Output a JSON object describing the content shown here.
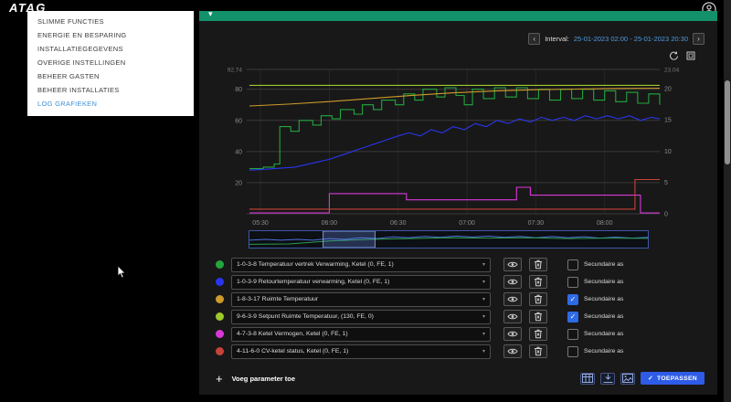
{
  "colors": {
    "accent_blue": "#4e9ae0",
    "apply_blue": "#2e5ce6",
    "active_menu": "#3f8fd6",
    "checkbox_checked": "#2e6be6",
    "header_green": "#12916a"
  },
  "brand": {
    "logo_text": "ATAG"
  },
  "sidebar": {
    "items": [
      {
        "label": "SLIMME FUNCTIES",
        "active": false
      },
      {
        "label": "ENERGIE EN BESPARING",
        "active": false
      },
      {
        "label": "INSTALLATIEGEGEVENS",
        "active": false
      },
      {
        "label": "OVERIGE INSTELLINGEN",
        "active": false
      },
      {
        "label": "BEHEER GASTEN",
        "active": false
      },
      {
        "label": "BEHEER INSTALLATIES",
        "active": false
      },
      {
        "label": "LOG GRAFIEKEN",
        "active": true
      }
    ]
  },
  "panel": {
    "header": {
      "collapse_glyph": "▾"
    },
    "interval": {
      "label": "Interval:",
      "value": "25-01-2023 02:00 - 25-01-2023 20:30",
      "prev_icon": "‹",
      "next_icon": "›"
    }
  },
  "legend": {
    "secondary_axis_label": "Secundaire as",
    "rows": [
      {
        "color": "#23a63e",
        "label": "1-0-3-8 Temperatuur vertrek Verwarming, Ketel (0, FE, 1)",
        "secondary": false
      },
      {
        "color": "#2a35f0",
        "label": "1-0-3-9 Retourtemperatuur verwarming, Ketel (0, FE, 1)",
        "secondary": false
      },
      {
        "color": "#cf9b2a",
        "label": "1-8-3-17 Ruimte Temperatuur",
        "secondary": true
      },
      {
        "color": "#9dc92c",
        "label": "9-6-3-9 Setpunt Ruimte Temperatuur, (130, FE, 0)",
        "secondary": true
      },
      {
        "color": "#d938d9",
        "label": "4-7-3-8 Ketel Vermogen, Ketel (0, FE, 1)",
        "secondary": false
      },
      {
        "color": "#c8423a",
        "label": "4-11-6-0 CV-ketel status, Ketel (0, FE, 1)",
        "secondary": false
      }
    ]
  },
  "footer": {
    "add_icon": "+",
    "add_label": "Voeg parameter toe",
    "apply_icon": "✓",
    "apply_label": "TOEPASSEN",
    "toolbar_icons": [
      "table",
      "download",
      "image"
    ]
  },
  "chart_data": {
    "type": "line",
    "title": "",
    "x_domain": [
      5.4,
      8.4
    ],
    "x_ticks": [
      {
        "v": 5.5,
        "label": "05:30"
      },
      {
        "v": 6.0,
        "label": "06:00"
      },
      {
        "v": 6.5,
        "label": "06:30"
      },
      {
        "v": 7.0,
        "label": "07:00"
      },
      {
        "v": 7.5,
        "label": "07:30"
      },
      {
        "v": 8.0,
        "label": "08:00"
      }
    ],
    "left_axis": {
      "max": 92.74,
      "top_label": "92.74",
      "ticks": [
        20,
        40,
        60,
        80
      ]
    },
    "right_axis": {
      "max": 23.04,
      "top_label": "23.04",
      "ticks": [
        5,
        10,
        15,
        20
      ],
      "bottom_label": "0"
    },
    "series": [
      {
        "name": "Temperatuur vertrek Verwarming",
        "color": "#23a63e",
        "axis": "left",
        "step": true,
        "points": [
          [
            5.42,
            29
          ],
          [
            5.52,
            30
          ],
          [
            5.6,
            32
          ],
          [
            5.64,
            56
          ],
          [
            5.72,
            53
          ],
          [
            5.78,
            60
          ],
          [
            5.88,
            57
          ],
          [
            5.94,
            63
          ],
          [
            6.02,
            61
          ],
          [
            6.08,
            67
          ],
          [
            6.18,
            64
          ],
          [
            6.24,
            70
          ],
          [
            6.32,
            67
          ],
          [
            6.38,
            73
          ],
          [
            6.48,
            70
          ],
          [
            6.54,
            77
          ],
          [
            6.62,
            73
          ],
          [
            6.68,
            80
          ],
          [
            6.78,
            75
          ],
          [
            6.84,
            81
          ],
          [
            6.92,
            76
          ],
          [
            6.98,
            70
          ],
          [
            7.04,
            80
          ],
          [
            7.12,
            74
          ],
          [
            7.2,
            81
          ],
          [
            7.28,
            75
          ],
          [
            7.36,
            81
          ],
          [
            7.44,
            74
          ],
          [
            7.52,
            80
          ],
          [
            7.6,
            73
          ],
          [
            7.68,
            80
          ],
          [
            7.76,
            74
          ],
          [
            7.84,
            80
          ],
          [
            7.92,
            73
          ],
          [
            8.0,
            79
          ],
          [
            8.08,
            72
          ],
          [
            8.16,
            78
          ],
          [
            8.24,
            71
          ],
          [
            8.32,
            77
          ],
          [
            8.4,
            70
          ]
        ]
      },
      {
        "name": "Retourtemperatuur verwarming",
        "color": "#2a35f0",
        "axis": "left",
        "step": false,
        "points": [
          [
            5.42,
            28
          ],
          [
            5.6,
            29
          ],
          [
            5.75,
            30
          ],
          [
            5.9,
            33
          ],
          [
            6.0,
            35
          ],
          [
            6.1,
            38
          ],
          [
            6.2,
            41
          ],
          [
            6.3,
            44
          ],
          [
            6.4,
            47
          ],
          [
            6.5,
            50
          ],
          [
            6.58,
            52
          ],
          [
            6.66,
            50
          ],
          [
            6.74,
            54
          ],
          [
            6.82,
            52
          ],
          [
            6.9,
            56
          ],
          [
            6.98,
            54
          ],
          [
            7.06,
            58
          ],
          [
            7.14,
            56
          ],
          [
            7.22,
            60
          ],
          [
            7.3,
            58
          ],
          [
            7.38,
            61
          ],
          [
            7.46,
            59
          ],
          [
            7.54,
            62
          ],
          [
            7.62,
            60
          ],
          [
            7.7,
            62
          ],
          [
            7.78,
            60
          ],
          [
            7.86,
            63
          ],
          [
            7.94,
            61
          ],
          [
            8.02,
            63
          ],
          [
            8.1,
            61
          ],
          [
            8.18,
            63
          ],
          [
            8.26,
            60
          ],
          [
            8.34,
            62
          ],
          [
            8.4,
            61
          ]
        ]
      },
      {
        "name": "Ruimte Temperatuur",
        "color": "#cf9b2a",
        "axis": "right",
        "step": false,
        "points": [
          [
            5.42,
            17.2
          ],
          [
            5.7,
            17.5
          ],
          [
            6.0,
            17.9
          ],
          [
            6.3,
            18.4
          ],
          [
            6.6,
            18.9
          ],
          [
            6.9,
            19.3
          ],
          [
            7.2,
            19.6
          ],
          [
            7.5,
            19.8
          ],
          [
            7.8,
            19.9
          ],
          [
            8.1,
            20.0
          ],
          [
            8.4,
            20.05
          ]
        ]
      },
      {
        "name": "Setpunt Ruimte Temperatuur",
        "color": "#9dc92c",
        "axis": "right",
        "step": true,
        "points": [
          [
            5.42,
            20.5
          ],
          [
            8.4,
            20.5
          ]
        ]
      },
      {
        "name": "Ketel Vermogen",
        "color": "#d938d9",
        "axis": "left",
        "step": true,
        "points": [
          [
            5.42,
            0.5
          ],
          [
            5.98,
            0.5
          ],
          [
            6.0,
            13
          ],
          [
            6.54,
            13
          ],
          [
            6.56,
            9
          ],
          [
            7.34,
            9
          ],
          [
            7.36,
            17
          ],
          [
            7.44,
            17
          ],
          [
            7.46,
            12
          ],
          [
            8.24,
            12
          ],
          [
            8.26,
            0.5
          ],
          [
            8.4,
            0.5
          ]
        ]
      },
      {
        "name": "CV-ketel status",
        "color": "#c8423a",
        "axis": "left",
        "step": true,
        "points": [
          [
            5.42,
            3
          ],
          [
            8.2,
            3
          ],
          [
            8.22,
            22
          ],
          [
            8.4,
            22
          ]
        ]
      }
    ],
    "navigator": {
      "selection": [
        0.185,
        0.315
      ],
      "series": [
        {
          "color": "#4a6fd8",
          "points": [
            [
              0,
              0.55
            ],
            [
              0.04,
              0.5
            ],
            [
              0.08,
              0.55
            ],
            [
              0.12,
              0.5
            ],
            [
              0.16,
              0.55
            ],
            [
              0.2,
              0.45
            ],
            [
              0.24,
              0.5
            ],
            [
              0.28,
              0.4
            ],
            [
              0.32,
              0.45
            ],
            [
              0.36,
              0.35
            ],
            [
              0.4,
              0.4
            ],
            [
              0.44,
              0.32
            ],
            [
              0.48,
              0.38
            ],
            [
              0.52,
              0.3
            ],
            [
              0.56,
              0.36
            ],
            [
              0.6,
              0.3
            ],
            [
              0.64,
              0.38
            ],
            [
              0.68,
              0.32
            ],
            [
              0.72,
              0.4
            ],
            [
              0.76,
              0.33
            ],
            [
              0.8,
              0.4
            ],
            [
              0.84,
              0.34
            ],
            [
              0.88,
              0.42
            ],
            [
              0.92,
              0.36
            ],
            [
              0.96,
              0.42
            ],
            [
              1,
              0.38
            ]
          ]
        },
        {
          "color": "#2c9c4a",
          "points": [
            [
              0,
              0.8
            ],
            [
              0.1,
              0.78
            ],
            [
              0.2,
              0.6
            ],
            [
              0.3,
              0.5
            ],
            [
              0.4,
              0.45
            ],
            [
              0.5,
              0.4
            ],
            [
              0.6,
              0.42
            ],
            [
              0.7,
              0.4
            ],
            [
              0.8,
              0.45
            ],
            [
              0.9,
              0.42
            ],
            [
              1,
              0.44
            ]
          ]
        }
      ]
    }
  }
}
